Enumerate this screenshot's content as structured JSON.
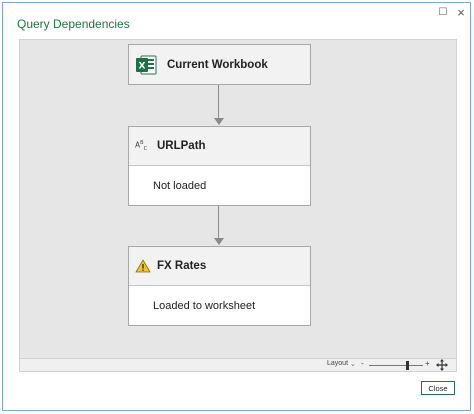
{
  "window": {
    "title": "Query Dependencies",
    "maximize_icon": "maximize-icon",
    "close_icon": "close-icon"
  },
  "nodes": [
    {
      "title": "Current Workbook",
      "icon": "excel-icon"
    },
    {
      "title": "URLPath",
      "icon": "text-type-icon",
      "status": "Not loaded"
    },
    {
      "title": "FX Rates",
      "icon": "warning-icon",
      "status": "Loaded to worksheet"
    }
  ],
  "statusbar": {
    "layout_label": "Layout",
    "zoom_out": "-",
    "zoom_in": "+",
    "zoom_level": 0.7
  },
  "footer": {
    "close_label": "Close"
  },
  "colors": {
    "accent": "#217346",
    "warning": "#f2c230"
  }
}
